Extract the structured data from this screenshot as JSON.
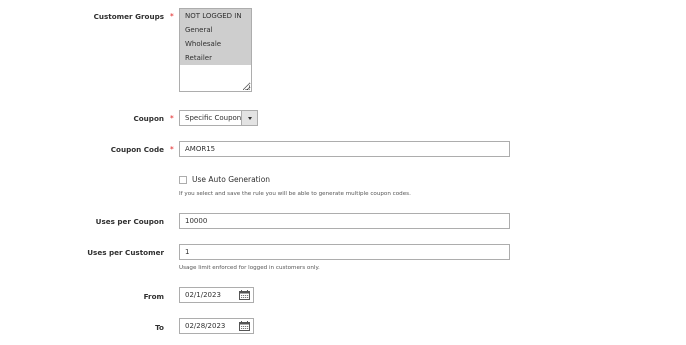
{
  "customer_groups": {
    "label": "Customer Groups",
    "options": [
      "NOT LOGGED IN",
      "General",
      "Wholesale",
      "Retailer"
    ]
  },
  "coupon": {
    "label": "Coupon",
    "selected": "Specific Coupon"
  },
  "coupon_code": {
    "label": "Coupon Code",
    "value": "AMOR15"
  },
  "auto_generation": {
    "label": "Use Auto Generation",
    "checked": false,
    "note": "If you select and save the rule you will be able to generate multiple coupon codes."
  },
  "uses_per_coupon": {
    "label": "Uses per Coupon",
    "value": "10000"
  },
  "uses_per_customer": {
    "label": "Uses per Customer",
    "value": "1",
    "note": "Usage limit enforced for logged in customers only."
  },
  "from_date": {
    "label": "From",
    "value": "02/1/2023"
  },
  "to_date": {
    "label": "To",
    "value": "02/28/2023"
  },
  "required_marker": "*",
  "colors": {
    "required": "#e22626",
    "selected_option_bg": "#cecece",
    "border": "#adadad"
  }
}
